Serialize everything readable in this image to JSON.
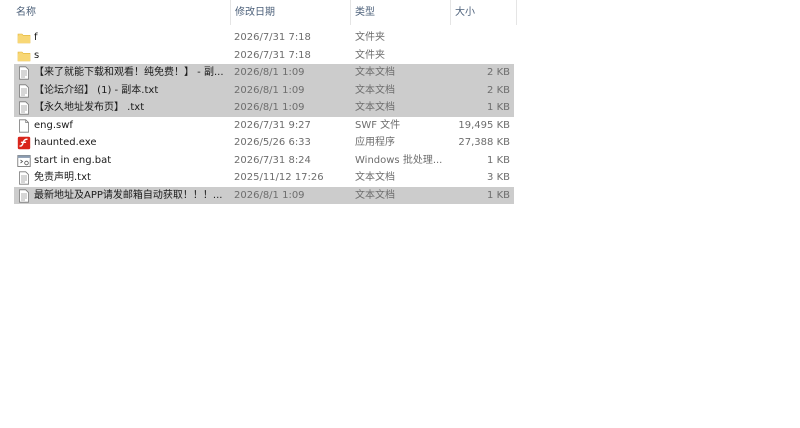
{
  "columns": {
    "name": "名称",
    "date": "修改日期",
    "type": "类型",
    "size": "大小",
    "sort_indicator": "^"
  },
  "colors": {
    "folder": "#f8d775",
    "folder_dark": "#e2b63b",
    "selection": "#cccccc",
    "header_text": "#4c607a",
    "secondary_text": "#6d6d6d",
    "flash_red": "#d9261c"
  },
  "files": [
    {
      "icon": "folder-icon",
      "name": "f",
      "date": "2026/7/31 7:18",
      "type": "文件夹",
      "size": "",
      "selected": false
    },
    {
      "icon": "folder-icon",
      "name": "s",
      "date": "2026/7/31 7:18",
      "type": "文件夹",
      "size": "",
      "selected": false
    },
    {
      "icon": "text-file-icon",
      "name": "【来了就能下载和观看！纯免费！】 - 副...",
      "date": "2026/8/1 1:09",
      "type": "文本文档",
      "size": "2 KB",
      "selected": true
    },
    {
      "icon": "text-file-icon",
      "name": "【论坛介绍】 (1) - 副本.txt",
      "date": "2026/8/1 1:09",
      "type": "文本文档",
      "size": "2 KB",
      "selected": true
    },
    {
      "icon": "text-file-icon",
      "name": "【永久地址发布页】 .txt",
      "date": "2026/8/1 1:09",
      "type": "文本文档",
      "size": "1 KB",
      "selected": true
    },
    {
      "icon": "blank-file-icon",
      "name": "eng.swf",
      "date": "2026/7/31 9:27",
      "type": "SWF 文件",
      "size": "19,495 KB",
      "selected": false
    },
    {
      "icon": "flash-app-icon",
      "name": "haunted.exe",
      "date": "2026/5/26 6:33",
      "type": "应用程序",
      "size": "27,388 KB",
      "selected": false
    },
    {
      "icon": "batch-file-icon",
      "name": "start in eng.bat",
      "date": "2026/7/31 8:24",
      "type": "Windows 批处理...",
      "size": "1 KB",
      "selected": false
    },
    {
      "icon": "text-file-icon",
      "name": "免责声明.txt",
      "date": "2025/11/12 17:26",
      "type": "文本文档",
      "size": "3 KB",
      "selected": false
    },
    {
      "icon": "text-file-icon",
      "name": "最新地址及APP请发邮箱自动获取！！！...",
      "date": "2026/8/1 1:09",
      "type": "文本文档",
      "size": "1 KB",
      "selected": true
    }
  ]
}
